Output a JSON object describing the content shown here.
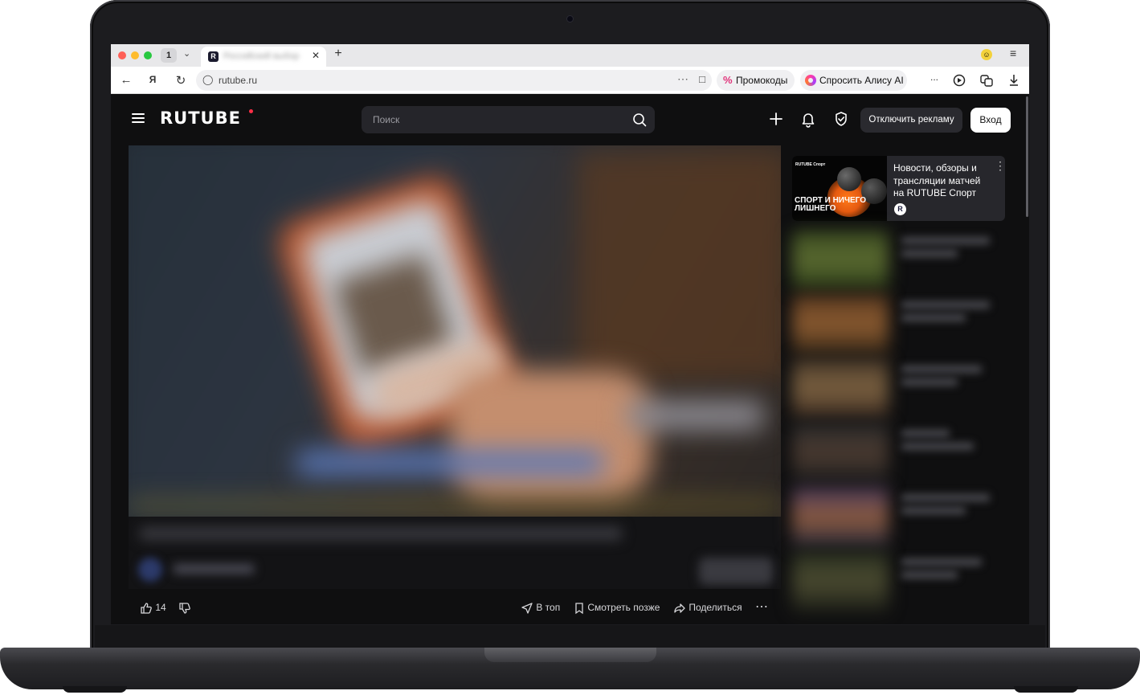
{
  "browser": {
    "tab_count": "1",
    "tab_title": "Российский выбор",
    "address": "rutube.ru",
    "promo_label": "Промокоды",
    "alice_label": "Спросить Алису AI",
    "more_label": "..."
  },
  "header": {
    "logo": "RUTUBE",
    "search_placeholder": "Поиск",
    "disable_ads_label": "Отключить рекламу",
    "login_label": "Вход"
  },
  "video": {
    "likes": "14",
    "to_top_label": "В топ",
    "watch_later_label": "Смотреть позже",
    "share_label": "Поделиться"
  },
  "sidebar": {
    "promo": {
      "thumb_logo": "RUTUBE Спорт",
      "thumb_text": "СПОРТ И НИЧЕГО ЛИШНЕГО",
      "title": "Новости, обзоры и трансляции матчей на RUTUBE Спорт",
      "channel_badge": "R"
    }
  },
  "colors": {
    "brand_red": "#ff2f47",
    "page_bg": "#0f0f10",
    "button_dark": "#2a2a2f"
  }
}
